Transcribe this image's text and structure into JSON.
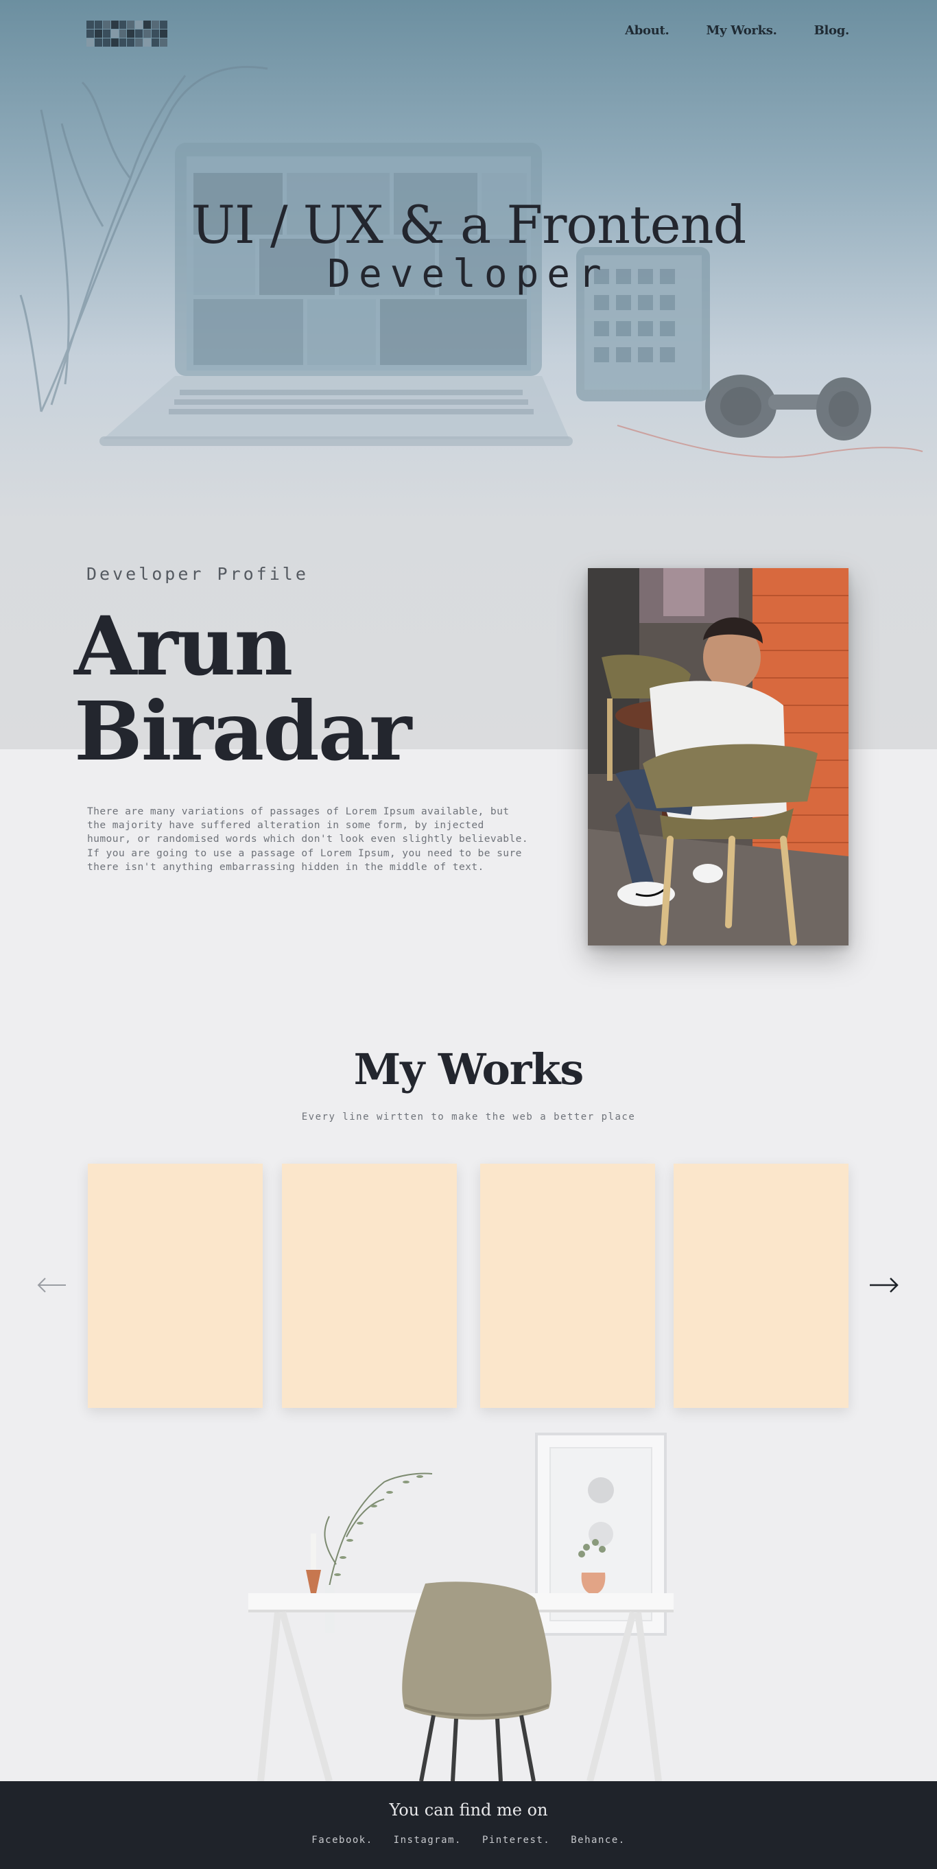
{
  "header": {
    "nav": [
      {
        "label": "About."
      },
      {
        "label": "My Works."
      },
      {
        "label": "Blog."
      }
    ]
  },
  "hero": {
    "title": "UI / UX & a Frontend",
    "subtitle": "Developer"
  },
  "profile": {
    "label": "Developer Profile",
    "first_name": "Arun",
    "last_name": "Biradar",
    "bio": "There are many variations of passages of Lorem Ipsum available, but the majority have suffered alteration in some form, by injected humour, or randomised words which don't look even slightly believable. If you are going to use a passage of Lorem Ipsum, you need to be sure there isn't anything embarrassing hidden in the middle of text."
  },
  "works": {
    "title": "My Works",
    "subtitle": "Every line wirtten to make the web a better place",
    "cards": [
      {},
      {},
      {},
      {}
    ]
  },
  "footer": {
    "title": "You can find me on",
    "links": [
      {
        "label": "Facebook."
      },
      {
        "label": "Instagram."
      },
      {
        "label": "Pinterest."
      },
      {
        "label": "Behance."
      }
    ]
  },
  "colors": {
    "card": "#fbe6cb",
    "footer_bg": "#1f232a",
    "text_dark": "#23262e",
    "hero_top": "#6c8fa0"
  },
  "icons": {
    "prev": "arrow-left-icon",
    "next": "arrow-right-icon"
  }
}
